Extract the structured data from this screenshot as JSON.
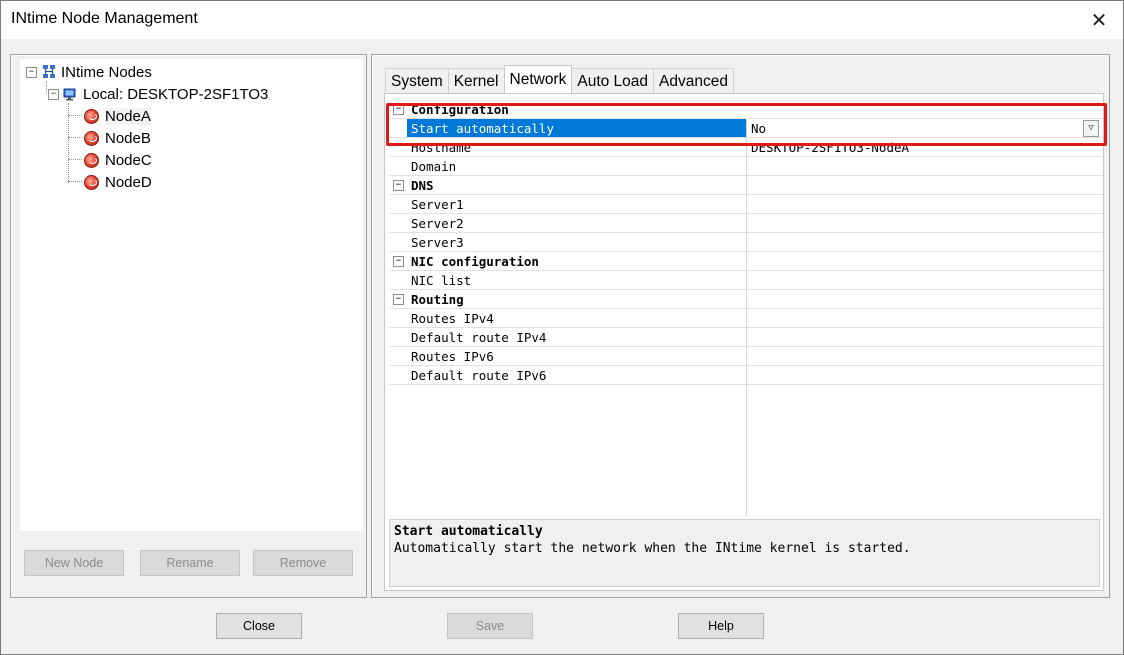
{
  "window": {
    "title": "INtime Node Management",
    "close_glyph": "✕"
  },
  "tree": {
    "root": "INtime Nodes",
    "local": "Local: DESKTOP-2SF1TO3",
    "nodes": [
      "NodeA",
      "NodeB",
      "NodeC",
      "NodeD"
    ],
    "selected": "NodeA",
    "expander_glyph": "−"
  },
  "left_buttons": {
    "new_node": "New Node",
    "rename": "Rename",
    "remove": "Remove"
  },
  "tabs": [
    "System",
    "Kernel",
    "Network",
    "Auto Load",
    "Advanced"
  ],
  "active_tab": "Network",
  "properties": {
    "categories": {
      "configuration": "Configuration",
      "dns": "DNS",
      "nic": "NIC configuration",
      "routing": "Routing"
    },
    "rows": {
      "start_automatically": {
        "name": "Start automatically",
        "value": "No"
      },
      "hostname": {
        "name": "Hostname",
        "value": "DESKTOP-2SF1TO3-NodeA"
      },
      "domain": {
        "name": "Domain",
        "value": ""
      },
      "server1": {
        "name": "Server1",
        "value": ""
      },
      "server2": {
        "name": "Server2",
        "value": ""
      },
      "server3": {
        "name": "Server3",
        "value": ""
      },
      "nic_list": {
        "name": "NIC list",
        "value": ""
      },
      "routes_ipv4": {
        "name": "Routes IPv4",
        "value": ""
      },
      "default_route_ipv4": {
        "name": "Default route IPv4",
        "value": ""
      },
      "routes_ipv6": {
        "name": "Routes IPv6",
        "value": ""
      },
      "default_route_ipv6": {
        "name": "Default route IPv6",
        "value": ""
      }
    }
  },
  "description": {
    "title": "Start automatically",
    "text": "Automatically start the network when the INtime kernel is started."
  },
  "bottom_buttons": {
    "close": "Close",
    "save": "Save",
    "help": "Help"
  },
  "colors": {
    "selection": "#0078d7",
    "highlight_box": "#e01818"
  }
}
